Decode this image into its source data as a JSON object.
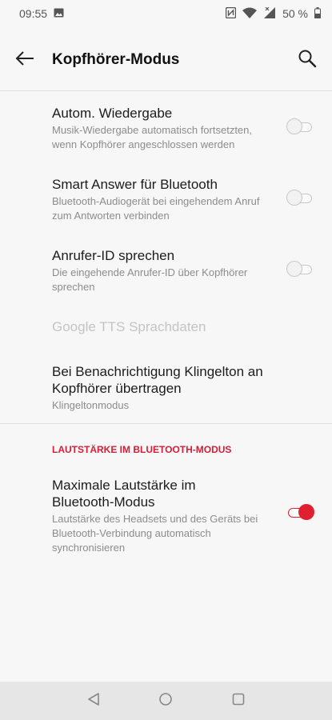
{
  "status_bar": {
    "time": "09:55",
    "battery": "50 %"
  },
  "header": {
    "title": "Kopfhörer-Modus"
  },
  "settings": [
    {
      "title": "Autom. Wiedergabe",
      "summary": "Musik-Wiedergabe automatisch fortsetzten, wenn Kopfhörer angeschlossen werden",
      "toggle": "off"
    },
    {
      "title": "Smart Answer für Bluetooth",
      "summary": "Bluetooth-Audiogerät bei eingehendem Anruf zum Antworten verbinden",
      "toggle": "off"
    },
    {
      "title": "Anrufer-ID sprechen",
      "summary": "Die eingehende Anrufer-ID über Kopfhörer sprechen",
      "toggle": "off"
    },
    {
      "title": "Google TTS Sprachdaten",
      "disabled": true
    },
    {
      "title": "Bei Benachrichtigung Klingelton an Kopfhörer übertragen",
      "summary": "Klingeltonmodus"
    }
  ],
  "bluetooth_section": {
    "header": "LAUTSTÄRKE IM BLUETOOTH-MODUS",
    "item": {
      "title": "Maximale Lautstärke im Bluetooth-Modus",
      "summary": "Lautstärke des Headsets und des Geräts bei Bluetooth-Verbindung automatisch synchronisieren",
      "toggle": "on"
    }
  },
  "colors": {
    "accent": "#e0202e",
    "section_header": "#d41e37",
    "background": "#f7f7f7"
  },
  "icons": [
    "image-icon",
    "nfc-icon",
    "wifi-icon",
    "signal-icon",
    "battery-icon",
    "back-arrow-icon",
    "search-icon",
    "nav-back-icon",
    "nav-home-icon",
    "nav-recents-icon"
  ]
}
